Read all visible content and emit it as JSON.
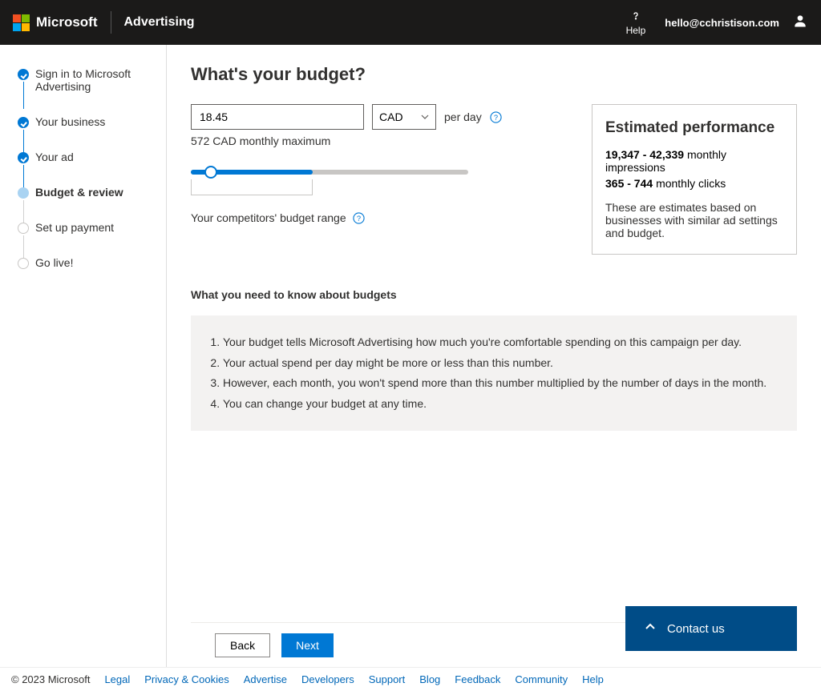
{
  "header": {
    "brand": "Microsoft",
    "product": "Advertising",
    "help_label": "Help",
    "user_email": "hello@cchristison.com"
  },
  "sidebar": {
    "steps": [
      {
        "label": "Sign in to Microsoft Advertising",
        "state": "done"
      },
      {
        "label": "Your business",
        "state": "done"
      },
      {
        "label": "Your ad",
        "state": "done"
      },
      {
        "label": "Budget & review",
        "state": "current"
      },
      {
        "label": "Set up payment",
        "state": "todo"
      },
      {
        "label": "Go live!",
        "state": "todo"
      }
    ]
  },
  "page": {
    "title": "What's your budget?",
    "budget_value": "18.45",
    "currency": "CAD",
    "per_day": "per day",
    "monthly_max": "572 CAD monthly maximum",
    "competitors_label": "Your competitors' budget range"
  },
  "performance": {
    "title": "Estimated performance",
    "impressions_range": "19,347 - 42,339",
    "impressions_label": "monthly impressions",
    "clicks_range": "365 - 744",
    "clicks_label": "monthly clicks",
    "note": "These are estimates based on businesses with similar ad settings and budget."
  },
  "know": {
    "title": "What you need to know about budgets",
    "items": [
      "Your budget tells Microsoft Advertising how much you're comfortable spending on this campaign per day.",
      "Your actual spend per day might be more or less than this number.",
      "However, each month, you won't spend more than this number multiplied by the number of days in the month.",
      "You can change your budget at any time."
    ]
  },
  "contact": {
    "label": "Contact us"
  },
  "nav": {
    "back": "Back",
    "next": "Next"
  },
  "footer": {
    "copy": "© 2023 Microsoft",
    "links": [
      "Legal",
      "Privacy & Cookies",
      "Advertise",
      "Developers",
      "Support",
      "Blog",
      "Feedback",
      "Community",
      "Help"
    ]
  }
}
